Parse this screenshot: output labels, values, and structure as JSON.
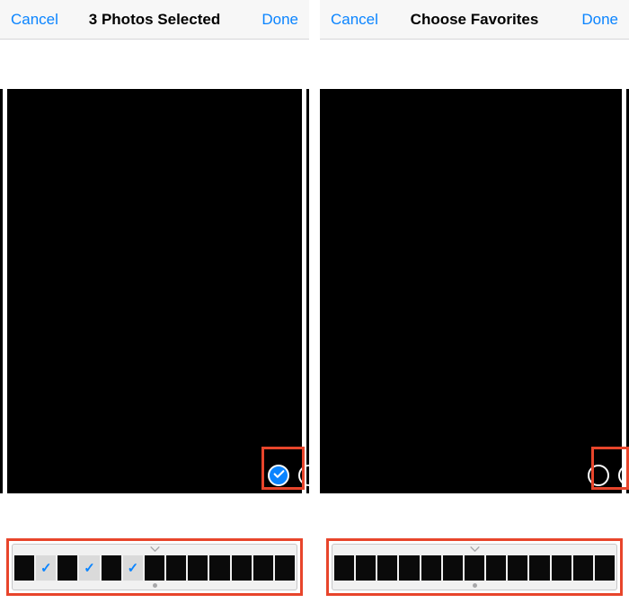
{
  "colors": {
    "accent": "#0a84ff",
    "callout": "#e8452b"
  },
  "left": {
    "navbar": {
      "cancel": "Cancel",
      "title": "3 Photos Selected",
      "done": "Done"
    },
    "main_photo_selected": true,
    "filmstrip": {
      "thumb_count": 13,
      "selected_indices": [
        1,
        3,
        5
      ]
    }
  },
  "right": {
    "navbar": {
      "cancel": "Cancel",
      "title": "Choose Favorites",
      "done": "Done"
    },
    "main_photo_selected": false,
    "filmstrip": {
      "thumb_count": 13,
      "selected_indices": []
    }
  }
}
